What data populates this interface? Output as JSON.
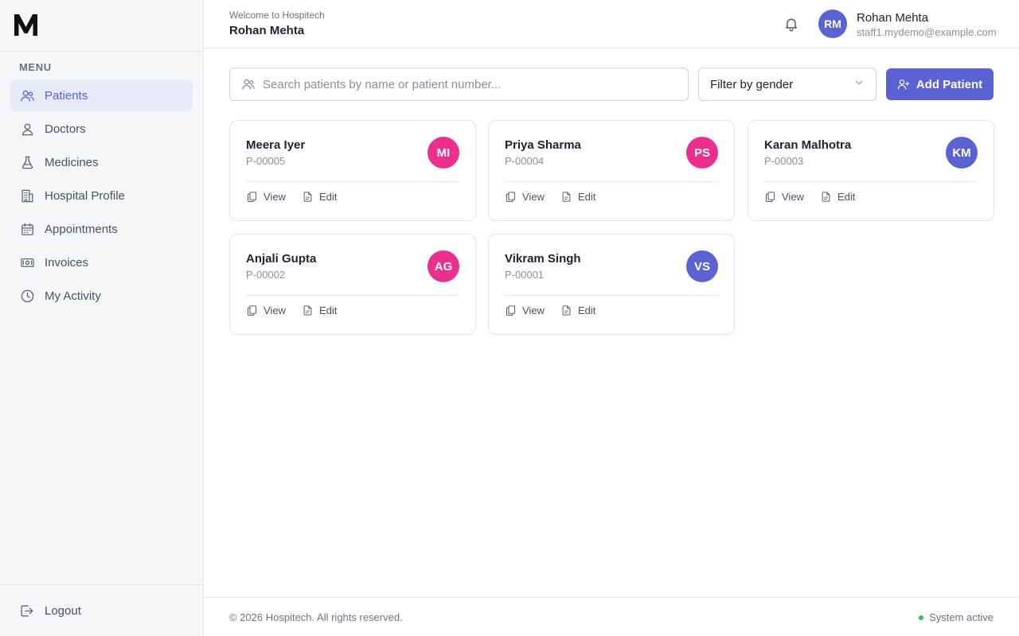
{
  "sidebar": {
    "logo_letter": "M",
    "menu_label": "MENU",
    "items": [
      {
        "label": "Patients",
        "icon": "users-icon",
        "active": true
      },
      {
        "label": "Doctors",
        "icon": "user-icon",
        "active": false
      },
      {
        "label": "Medicines",
        "icon": "flask-icon",
        "active": false
      },
      {
        "label": "Hospital Profile",
        "icon": "building-icon",
        "active": false
      },
      {
        "label": "Appointments",
        "icon": "calendar-icon",
        "active": false
      },
      {
        "label": "Invoices",
        "icon": "banknote-icon",
        "active": false
      },
      {
        "label": "My Activity",
        "icon": "clock-icon",
        "active": false
      }
    ],
    "logout_label": "Logout"
  },
  "header": {
    "welcome": "Welcome to Hospitech",
    "name": "Rohan Mehta",
    "user": {
      "initials": "RM",
      "name": "Rohan Mehta",
      "email": "staff1.mydemo@example.com"
    }
  },
  "toolbar": {
    "search_placeholder": "Search patients by name or patient number...",
    "filter_label": "Filter by gender",
    "add_label": "Add Patient"
  },
  "patients": [
    {
      "name": "Meera Iyer",
      "number": "P-00005",
      "initials": "MI",
      "color": "#ec2e8c"
    },
    {
      "name": "Priya Sharma",
      "number": "P-00004",
      "initials": "PS",
      "color": "#ec2e8c"
    },
    {
      "name": "Karan Malhotra",
      "number": "P-00003",
      "initials": "KM",
      "color": "#5b63d3"
    },
    {
      "name": "Anjali Gupta",
      "number": "P-00002",
      "initials": "AG",
      "color": "#ec2e8c"
    },
    {
      "name": "Vikram Singh",
      "number": "P-00001",
      "initials": "VS",
      "color": "#5b63d3"
    }
  ],
  "card_actions": {
    "view": "View",
    "edit": "Edit"
  },
  "footer": {
    "copyright": "© 2026 Hospitech. All rights reserved.",
    "status": "System active"
  },
  "colors": {
    "accent": "#5b63d3",
    "pink": "#ec2e8c",
    "status_green": "#22c55e"
  }
}
